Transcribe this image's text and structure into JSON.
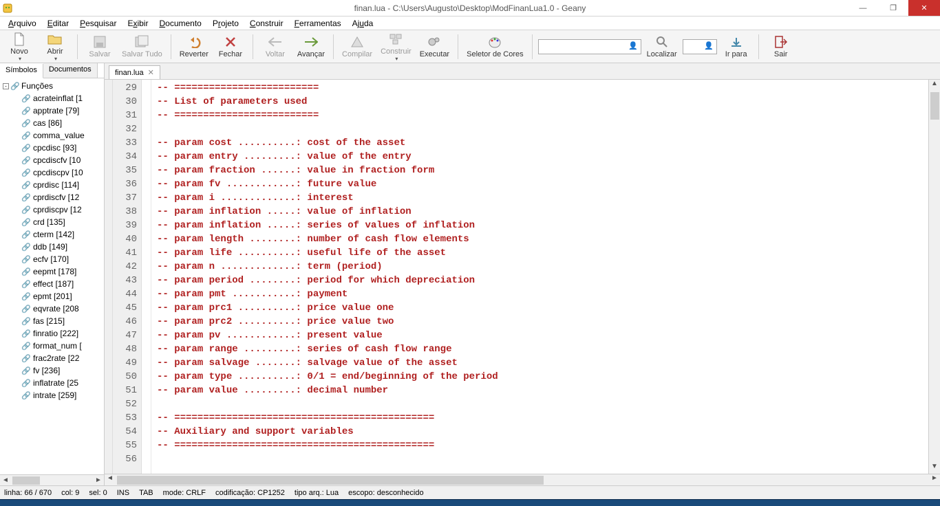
{
  "window": {
    "title": "finan.lua - C:\\Users\\Augusto\\Desktop\\ModFinanLua1.0 - Geany"
  },
  "menus": [
    "Arquivo",
    "Editar",
    "Pesquisar",
    "Exibir",
    "Documento",
    "Projeto",
    "Construir",
    "Ferramentas",
    "Ajuda"
  ],
  "toolbar": {
    "novo": "Novo",
    "abrir": "Abrir",
    "salvar": "Salvar",
    "salvar_tudo": "Salvar Tudo",
    "reverter": "Reverter",
    "fechar": "Fechar",
    "voltar": "Voltar",
    "avancar": "Avançar",
    "compilar": "Compilar",
    "construir": "Construir",
    "executar": "Executar",
    "seletor": "Seletor de Cores",
    "localizar": "Localizar",
    "irpara": "Ir para",
    "sair": "Sair"
  },
  "side_tabs": {
    "symbols": "Símbolos",
    "docs": "Documentos"
  },
  "symbols_root": "Funções",
  "symbols": [
    {
      "name": "acrateinflat",
      "loc": "[1"
    },
    {
      "name": "apptrate",
      "loc": "[79]"
    },
    {
      "name": "cas",
      "loc": "[86]"
    },
    {
      "name": "comma_value",
      "loc": ""
    },
    {
      "name": "cpcdisc",
      "loc": "[93]"
    },
    {
      "name": "cpcdiscfv",
      "loc": "[10"
    },
    {
      "name": "cpcdiscpv",
      "loc": "[10"
    },
    {
      "name": "cprdisc",
      "loc": "[114]"
    },
    {
      "name": "cprdiscfv",
      "loc": "[12"
    },
    {
      "name": "cprdiscpv",
      "loc": "[12"
    },
    {
      "name": "crd",
      "loc": "[135]"
    },
    {
      "name": "cterm",
      "loc": "[142]"
    },
    {
      "name": "ddb",
      "loc": "[149]"
    },
    {
      "name": "ecfv",
      "loc": "[170]"
    },
    {
      "name": "eepmt",
      "loc": "[178]"
    },
    {
      "name": "effect",
      "loc": "[187]"
    },
    {
      "name": "epmt",
      "loc": "[201]"
    },
    {
      "name": "eqvrate",
      "loc": "[208"
    },
    {
      "name": "fas",
      "loc": "[215]"
    },
    {
      "name": "finratio",
      "loc": "[222]"
    },
    {
      "name": "format_num",
      "loc": "["
    },
    {
      "name": "frac2rate",
      "loc": "[22"
    },
    {
      "name": "fv",
      "loc": "[236]"
    },
    {
      "name": "inflatrate",
      "loc": "[25"
    },
    {
      "name": "intrate",
      "loc": "[259]"
    }
  ],
  "editor_tab": {
    "label": "finan.lua"
  },
  "code_start_line": 29,
  "code_lines": [
    "-- =========================",
    "-- List of parameters used",
    "-- =========================",
    "",
    "-- param cost ..........: cost of the asset",
    "-- param entry .........: value of the entry",
    "-- param fraction ......: value in fraction form",
    "-- param fv ............: future value",
    "-- param i .............: interest",
    "-- param inflation .....: value of inflation",
    "-- param inflation .....: series of values of inflation",
    "-- param length ........: number of cash flow elements",
    "-- param life ..........: useful life of the asset",
    "-- param n .............: term (period)",
    "-- param period ........: period for which depreciation",
    "-- param pmt ...........: payment",
    "-- param prc1 ..........: price value one",
    "-- param prc2 ..........: price value two",
    "-- param pv ............: present value",
    "-- param range .........: series of cash flow range",
    "-- param salvage .......: salvage value of the asset",
    "-- param type ..........: 0/1 = end/beginning of the period",
    "-- param value .........: decimal number",
    "",
    "-- =============================================",
    "-- Auxiliary and support variables",
    "-- =============================================",
    ""
  ],
  "status": {
    "linha": "linha: 66 / 670",
    "col": "col: 9",
    "sel": "sel: 0",
    "ins": "INS",
    "tab": "TAB",
    "mode": "mode: CRLF",
    "codif": "codificação: CP1252",
    "tipo": "tipo arq.: Lua",
    "escopo": "escopo: desconhecido"
  }
}
